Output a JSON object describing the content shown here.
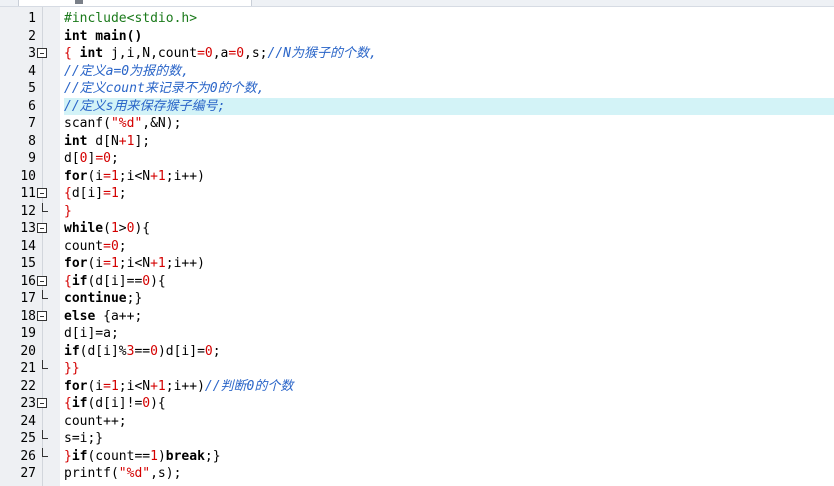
{
  "editor": {
    "highlighted_line": "6",
    "lines": [
      {
        "num": "1",
        "fold": "",
        "tokens": [
          {
            "t": "#include<stdio.h>",
            "c": "p"
          }
        ]
      },
      {
        "num": "2",
        "fold": "",
        "tokens": [
          {
            "t": "int main()",
            "c": "k"
          }
        ]
      },
      {
        "num": "3",
        "fold": "box",
        "tokens": [
          {
            "t": "{ ",
            "c": "o"
          },
          {
            "t": "int",
            "c": "k"
          },
          {
            "t": " j,i,N,count",
            "c": ""
          },
          {
            "t": "=0",
            "c": "n"
          },
          {
            "t": ",a",
            "c": ""
          },
          {
            "t": "=0",
            "c": "n"
          },
          {
            "t": ",s;",
            "c": ""
          },
          {
            "t": "//N为猴子的个数,",
            "c": "c"
          }
        ]
      },
      {
        "num": "4",
        "fold": "",
        "tokens": [
          {
            "t": "//定义a=0为报的数,",
            "c": "c"
          }
        ]
      },
      {
        "num": "5",
        "fold": "",
        "tokens": [
          {
            "t": "//定义count来记录不为0的个数,",
            "c": "c"
          }
        ]
      },
      {
        "num": "6",
        "fold": "",
        "tokens": [
          {
            "t": "//定义s用来保存猴子编号;",
            "c": "c"
          }
        ]
      },
      {
        "num": "7",
        "fold": "",
        "tokens": [
          {
            "t": "scanf(",
            "c": ""
          },
          {
            "t": "\"%d\"",
            "c": "s"
          },
          {
            "t": ",&N);",
            "c": ""
          }
        ]
      },
      {
        "num": "8",
        "fold": "",
        "tokens": [
          {
            "t": "int",
            "c": "k"
          },
          {
            "t": " d[N",
            "c": ""
          },
          {
            "t": "+1",
            "c": "n"
          },
          {
            "t": "];",
            "c": ""
          }
        ]
      },
      {
        "num": "9",
        "fold": "",
        "tokens": [
          {
            "t": "d[",
            "c": ""
          },
          {
            "t": "0",
            "c": "n"
          },
          {
            "t": "]",
            "c": ""
          },
          {
            "t": "=0",
            "c": "n"
          },
          {
            "t": ";",
            "c": ""
          }
        ]
      },
      {
        "num": "10",
        "fold": "",
        "tokens": [
          {
            "t": "for",
            "c": "k"
          },
          {
            "t": "(i",
            "c": ""
          },
          {
            "t": "=1",
            "c": "n"
          },
          {
            "t": ";i<N",
            "c": ""
          },
          {
            "t": "+1",
            "c": "n"
          },
          {
            "t": ";i++)",
            "c": ""
          }
        ]
      },
      {
        "num": "11",
        "fold": "box",
        "tokens": [
          {
            "t": "{",
            "c": "o"
          },
          {
            "t": "d[i]",
            "c": ""
          },
          {
            "t": "=1",
            "c": "n"
          },
          {
            "t": ";",
            "c": ""
          }
        ]
      },
      {
        "num": "12",
        "fold": "end",
        "tokens": [
          {
            "t": "}",
            "c": "o"
          }
        ]
      },
      {
        "num": "13",
        "fold": "box",
        "tokens": [
          {
            "t": "while",
            "c": "k"
          },
          {
            "t": "(",
            "c": ""
          },
          {
            "t": "1",
            "c": "n"
          },
          {
            "t": ">",
            "c": ""
          },
          {
            "t": "0",
            "c": "n"
          },
          {
            "t": "){",
            "c": ""
          }
        ]
      },
      {
        "num": "14",
        "fold": "",
        "tokens": [
          {
            "t": "count",
            "c": ""
          },
          {
            "t": "=0",
            "c": "n"
          },
          {
            "t": ";",
            "c": ""
          }
        ]
      },
      {
        "num": "15",
        "fold": "",
        "tokens": [
          {
            "t": "for",
            "c": "k"
          },
          {
            "t": "(i",
            "c": ""
          },
          {
            "t": "=1",
            "c": "n"
          },
          {
            "t": ";i<N",
            "c": ""
          },
          {
            "t": "+1",
            "c": "n"
          },
          {
            "t": ";i++)",
            "c": ""
          }
        ]
      },
      {
        "num": "16",
        "fold": "box",
        "tokens": [
          {
            "t": "{",
            "c": "o"
          },
          {
            "t": "if",
            "c": "k"
          },
          {
            "t": "(d[i]==",
            "c": ""
          },
          {
            "t": "0",
            "c": "n"
          },
          {
            "t": "){",
            "c": ""
          }
        ]
      },
      {
        "num": "17",
        "fold": "end",
        "tokens": [
          {
            "t": "continue",
            "c": "k"
          },
          {
            "t": ";}",
            "c": ""
          }
        ]
      },
      {
        "num": "18",
        "fold": "box",
        "tokens": [
          {
            "t": "else",
            "c": "k"
          },
          {
            "t": " {a++;",
            "c": ""
          }
        ]
      },
      {
        "num": "19",
        "fold": "",
        "tokens": [
          {
            "t": "d[i]=a;",
            "c": ""
          }
        ]
      },
      {
        "num": "20",
        "fold": "",
        "tokens": [
          {
            "t": "if",
            "c": "k"
          },
          {
            "t": "(d[i]%",
            "c": ""
          },
          {
            "t": "3",
            "c": "n"
          },
          {
            "t": "==",
            "c": ""
          },
          {
            "t": "0",
            "c": "n"
          },
          {
            "t": ")d[i]=",
            "c": ""
          },
          {
            "t": "0",
            "c": "n"
          },
          {
            "t": ";",
            "c": ""
          }
        ]
      },
      {
        "num": "21",
        "fold": "end",
        "tokens": [
          {
            "t": "}}",
            "c": "o"
          }
        ]
      },
      {
        "num": "22",
        "fold": "",
        "tokens": [
          {
            "t": "for",
            "c": "k"
          },
          {
            "t": "(i",
            "c": ""
          },
          {
            "t": "=1",
            "c": "n"
          },
          {
            "t": ";i<N",
            "c": ""
          },
          {
            "t": "+1",
            "c": "n"
          },
          {
            "t": ";i++)",
            "c": ""
          },
          {
            "t": "//判断0的个数",
            "c": "c"
          }
        ]
      },
      {
        "num": "23",
        "fold": "box",
        "tokens": [
          {
            "t": "{",
            "c": "o"
          },
          {
            "t": "if",
            "c": "k"
          },
          {
            "t": "(d[i]!=",
            "c": ""
          },
          {
            "t": "0",
            "c": "n"
          },
          {
            "t": "){",
            "c": ""
          }
        ]
      },
      {
        "num": "24",
        "fold": "",
        "tokens": [
          {
            "t": "count++;",
            "c": ""
          }
        ]
      },
      {
        "num": "25",
        "fold": "end",
        "tokens": [
          {
            "t": "s=i;}",
            "c": ""
          }
        ]
      },
      {
        "num": "26",
        "fold": "end",
        "tokens": [
          {
            "t": "}",
            "c": "o"
          },
          {
            "t": "if",
            "c": "k"
          },
          {
            "t": "(count==",
            "c": ""
          },
          {
            "t": "1",
            "c": "n"
          },
          {
            "t": ")",
            "c": ""
          },
          {
            "t": "break",
            "c": "k"
          },
          {
            "t": ";}",
            "c": ""
          }
        ]
      },
      {
        "num": "27",
        "fold": "",
        "tokens": [
          {
            "t": "printf(",
            "c": ""
          },
          {
            "t": "\"%d\"",
            "c": "s"
          },
          {
            "t": ",s);",
            "c": ""
          }
        ]
      }
    ]
  }
}
